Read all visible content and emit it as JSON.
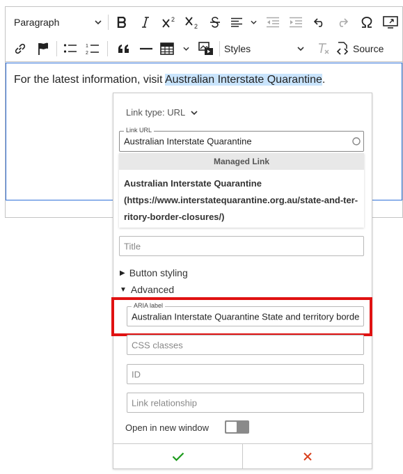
{
  "toolbar": {
    "heading_value": "Paragraph",
    "styles_value": "Styles",
    "source_label": "Source"
  },
  "content": {
    "text_before": "For the latest information, visit ",
    "link_text": "Australian Interstate Quarantine",
    "text_after": "."
  },
  "link_dialog": {
    "link_type": "Link type: URL",
    "link_url": {
      "label": "Link URL",
      "value": "Australian Interstate Quarantine"
    },
    "managed_link": {
      "header": "Managed Link",
      "title": "Australian Interstate Quarantine",
      "url_line1": "(https://www.interstatequarantine.org.au/state-and-ter-",
      "url_line2": "ritory-border-closures/)"
    },
    "title_placeholder": "Title",
    "button_styling": "Button styling",
    "advanced": "Advanced",
    "aria_label": {
      "label": "ARIA label",
      "value": "Australian Interstate Quarantine State and territory borde"
    },
    "css_classes_placeholder": "CSS classes",
    "id_placeholder": "ID",
    "link_relationship_placeholder": "Link relationship",
    "open_new_window": "Open in new window",
    "open_new_window_checked": false
  },
  "colors": {
    "selection": "#c9e4fc",
    "focus_border": "#2e6fd8",
    "highlight_box": "#e01212",
    "confirm": "#1a9a1a",
    "cancel": "#d9411e"
  }
}
